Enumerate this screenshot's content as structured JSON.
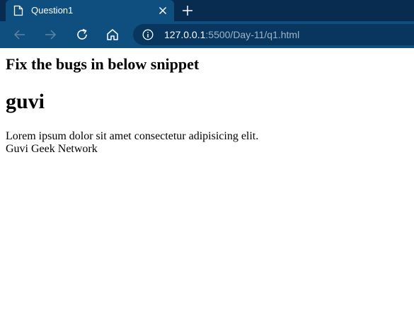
{
  "browser": {
    "tab": {
      "title": "Question1",
      "favicon": "page-icon",
      "close_icon": "close-icon"
    },
    "new_tab_icon": "plus-icon",
    "toolbar": {
      "back_icon": "arrow-left-icon",
      "forward_icon": "arrow-right-icon",
      "reload_icon": "reload-icon",
      "home_icon": "home-icon"
    },
    "address": {
      "info_icon": "info-icon",
      "host": "127.0.0.1",
      "path": ":5500/Day-11/q1.html"
    },
    "colors": {
      "tab_strip": "#072c4f",
      "active_tab": "#0e4f80",
      "address_bar": "#08365e"
    }
  },
  "page": {
    "heading": "Fix the bugs in below snippet",
    "title": "guvi",
    "paragraph_line1": "Lorem ipsum dolor sit amet consectetur adipisicing elit.",
    "paragraph_line2": "Guvi Geek Network"
  }
}
